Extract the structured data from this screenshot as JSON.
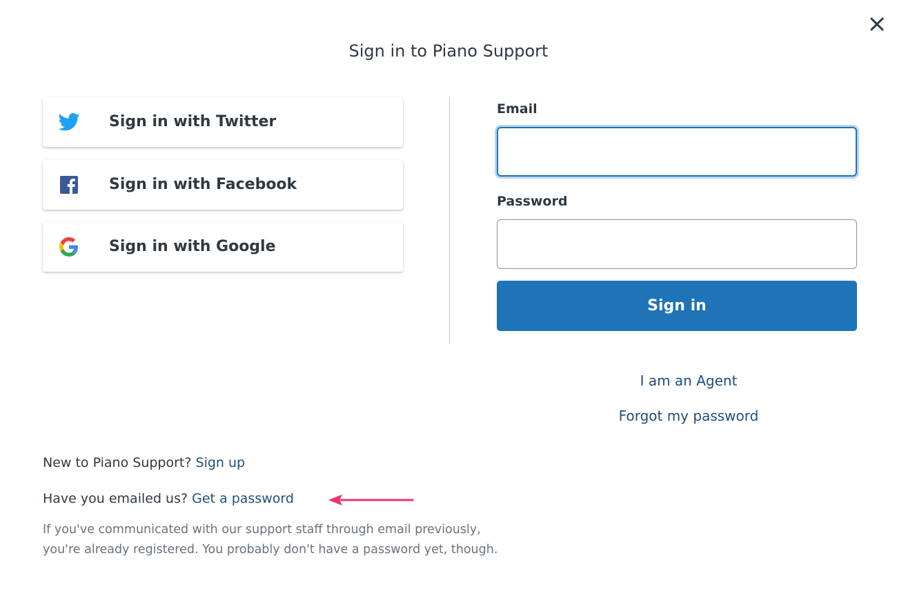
{
  "dialog": {
    "title": "Sign in to Piano Support",
    "close_icon": "close-icon"
  },
  "social": {
    "twitter": {
      "label": "Sign in with Twitter",
      "icon": "twitter-icon",
      "color": "#1da1f2"
    },
    "facebook": {
      "label": "Sign in with Facebook",
      "icon": "facebook-icon",
      "color": "#3b5998"
    },
    "google": {
      "label": "Sign in with Google",
      "icon": "google-icon"
    }
  },
  "form": {
    "email_label": "Email",
    "email_value": "",
    "password_label": "Password",
    "password_value": "",
    "submit_label": "Sign in",
    "submit_color": "#1f73b7"
  },
  "links": {
    "agent": "I am an Agent",
    "forgot": "Forgot my password"
  },
  "footer": {
    "new_text": "New to Piano Support?",
    "signup_link": "Sign up",
    "emailed_text": "Have you emailed us?",
    "get_password_link": "Get a password",
    "note_line1": "If you've communicated with our support staff through email previously,",
    "note_line2": "you're already registered. You probably don't have a password yet, though.",
    "arrow_color": "#e8356d"
  }
}
